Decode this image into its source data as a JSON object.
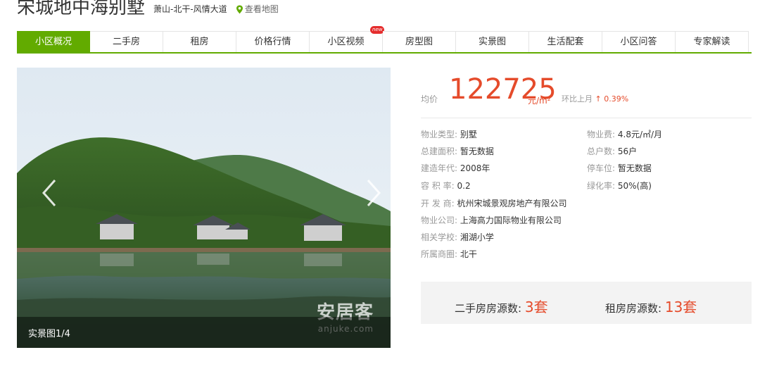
{
  "header": {
    "title": "宋城地中海别墅",
    "location": "萧山-北干-风情大道",
    "map_link": "查看地图",
    "map_icon": "location-pin-icon"
  },
  "tabs": [
    {
      "label": "小区概况",
      "active": true
    },
    {
      "label": "二手房"
    },
    {
      "label": "租房"
    },
    {
      "label": "价格行情"
    },
    {
      "label": "小区视频",
      "badge": "new"
    },
    {
      "label": "房型图"
    },
    {
      "label": "实景图"
    },
    {
      "label": "生活配套"
    },
    {
      "label": "小区问答"
    },
    {
      "label": "专家解读"
    }
  ],
  "gallery": {
    "caption": "实景图1/4",
    "watermark": "安居客",
    "watermark_sub": "anjuke.com"
  },
  "price": {
    "label": "均价",
    "value": "122725",
    "unit": "元/m²",
    "change_label": "环比上月",
    "change_value": "↑ 0.39%"
  },
  "info_left": [
    {
      "key": "物业类型:",
      "value": "别墅"
    },
    {
      "key": "总建面积:",
      "value": "暂无数据"
    },
    {
      "key": "建造年代:",
      "value": "2008年"
    },
    {
      "key": "容 积 率:",
      "value": "0.2"
    },
    {
      "key": "开 发 商:",
      "value": "杭州宋城景观房地产有限公司"
    },
    {
      "key": "物业公司:",
      "value": "上海高力国际物业有限公司"
    },
    {
      "key": "相关学校:",
      "value": "湘湖小学"
    },
    {
      "key": "所属商圈:",
      "value": "北干"
    }
  ],
  "info_right": [
    {
      "key": "物业费:",
      "value": "4.8元/㎡/月"
    },
    {
      "key": "总户数:",
      "value": "56户"
    },
    {
      "key": "停车位:",
      "value": "暂无数据"
    },
    {
      "key": "绿化率:",
      "value": "50%(高)"
    }
  ],
  "counts": {
    "secondhand_label": "二手房房源数:",
    "secondhand_value": "3套",
    "rental_label": "租房房源数:",
    "rental_value": "13套"
  },
  "colors": {
    "accent_green": "#62ab00",
    "price_red": "#e54b2b"
  }
}
